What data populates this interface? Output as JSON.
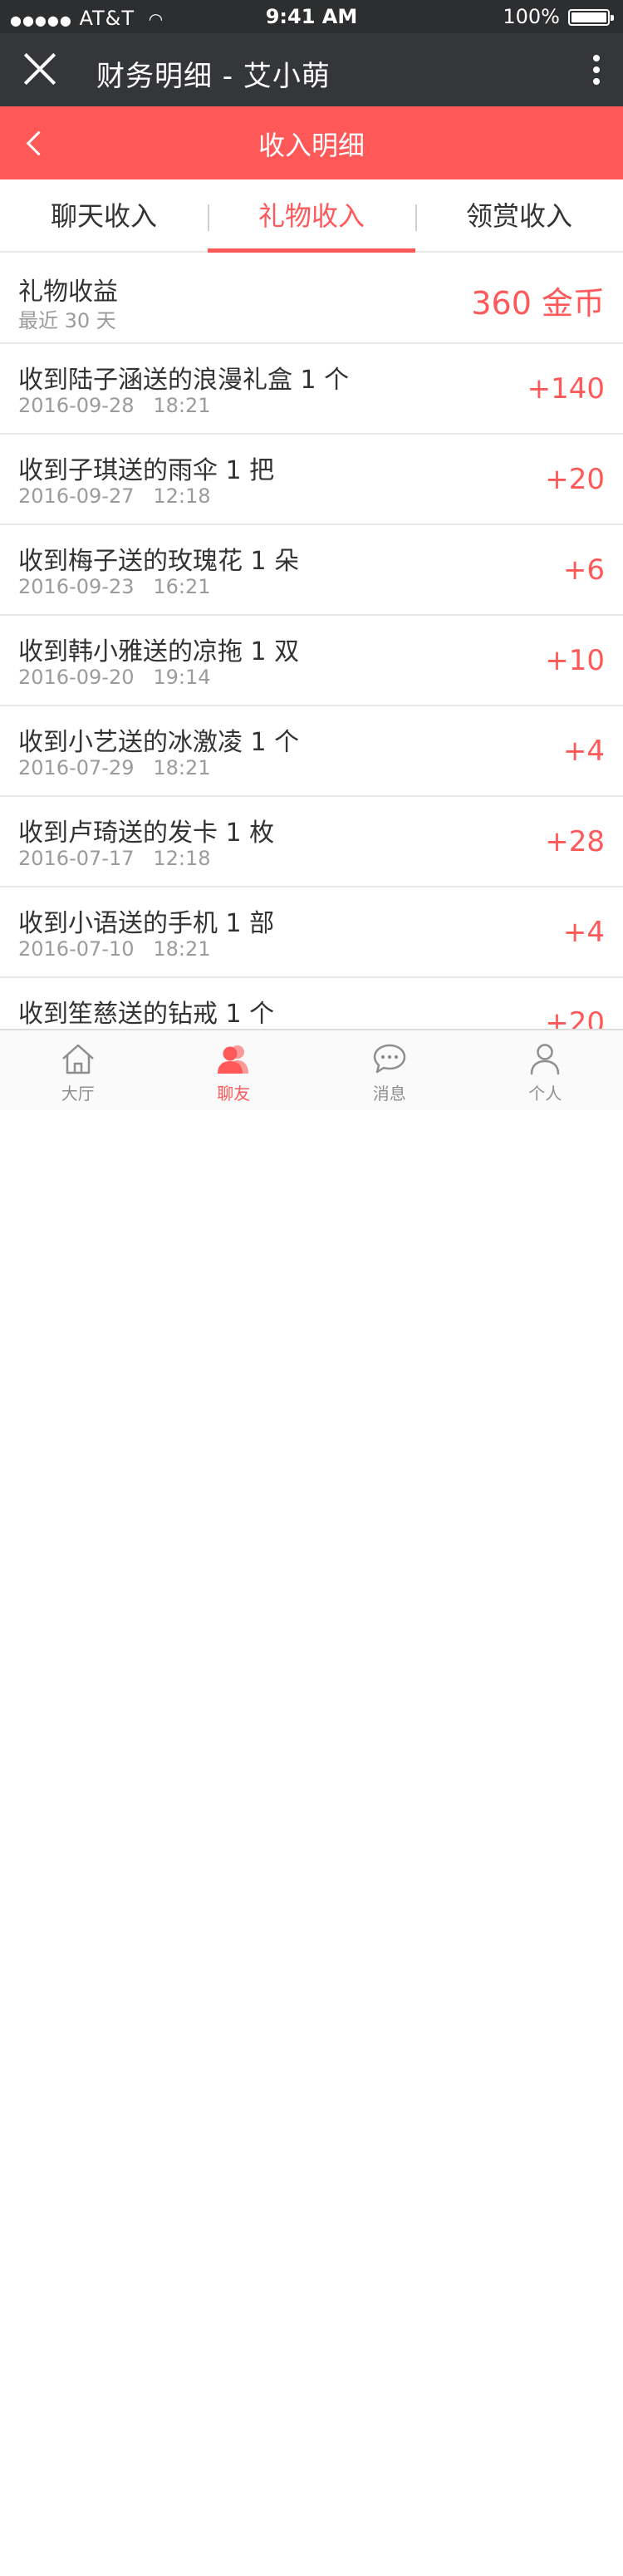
{
  "status_bar": {
    "carrier": "AT&T",
    "time": "9:41 AM",
    "battery": "100%"
  },
  "title_bar": {
    "title": "财务明细 - 艾小萌"
  },
  "nav_bar": {
    "title": "收入明细"
  },
  "tabs": [
    {
      "label": "聊天收入",
      "active": false
    },
    {
      "label": "礼物收入",
      "active": true
    },
    {
      "label": "领赏收入",
      "active": false
    }
  ],
  "summary": {
    "label": "礼物收益",
    "period": "最近 30 天",
    "total": "360 金币"
  },
  "records": [
    {
      "desc": "收到陆子涵送的浪漫礼盒 1 个",
      "date": "2016-09-28",
      "time": "18:21",
      "amount": "+140"
    },
    {
      "desc": "收到子琪送的雨伞 1 把",
      "date": "2016-09-27",
      "time": "12:18",
      "amount": "+20"
    },
    {
      "desc": "收到梅子送的玫瑰花 1 朵",
      "date": "2016-09-23",
      "time": "16:21",
      "amount": "+6"
    },
    {
      "desc": "收到韩小雅送的凉拖 1 双",
      "date": "2016-09-20",
      "time": "19:14",
      "amount": "+10"
    },
    {
      "desc": "收到小艺送的冰激凌 1 个",
      "date": "2016-07-29",
      "time": "18:21",
      "amount": "+4"
    },
    {
      "desc": "收到卢琦送的发卡 1 枚",
      "date": "2016-07-17",
      "time": "12:18",
      "amount": "+28"
    },
    {
      "desc": "收到小语送的手机 1 部",
      "date": "2016-07-10",
      "time": "18:21",
      "amount": "+4"
    },
    {
      "desc": "收到笙慈送的钻戒 1 个",
      "date": "",
      "time": "",
      "amount": "+20"
    }
  ],
  "bottom_tabs": [
    {
      "label": "大厅",
      "icon": "home-icon",
      "active": false
    },
    {
      "label": "聊友",
      "icon": "friends-icon",
      "active": true
    },
    {
      "label": "消息",
      "icon": "message-icon",
      "active": false
    },
    {
      "label": "个人",
      "icon": "person-icon",
      "active": false
    }
  ],
  "colors": {
    "accent": "#fe5859",
    "title_bar": "#35363a",
    "status_bar": "#2d2e30",
    "muted_text": "#9b9b9b"
  }
}
